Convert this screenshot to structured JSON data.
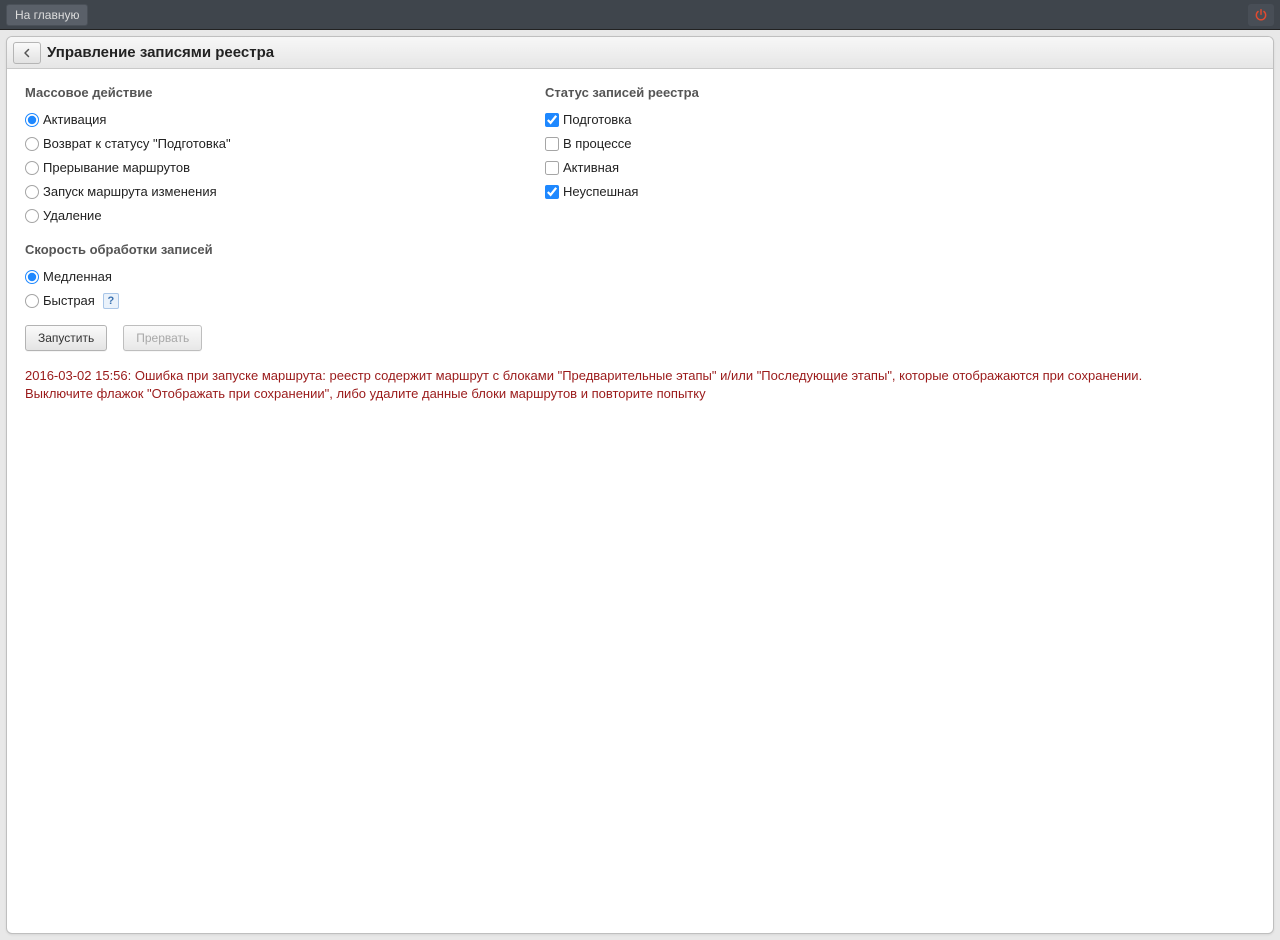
{
  "appbar": {
    "home_label": "На главную"
  },
  "panel": {
    "title": "Управление записями реестра"
  },
  "mass_action": {
    "label": "Массовое действие",
    "options": {
      "activation": "Активация",
      "return_prep": "Возврат к статусу \"Подготовка\"",
      "interrupt": "Прерывание маршрутов",
      "start_change": "Запуск маршрута изменения",
      "delete": "Удаление"
    },
    "selected": "activation"
  },
  "status": {
    "label": "Статус записей реестра",
    "options": {
      "prep": {
        "label": "Подготовка",
        "checked": true
      },
      "in_process": {
        "label": "В процессе",
        "checked": false
      },
      "active": {
        "label": "Активная",
        "checked": false
      },
      "failed": {
        "label": "Неуспешная",
        "checked": true
      }
    }
  },
  "speed": {
    "label": "Скорость обработки записей",
    "options": {
      "slow": "Медленная",
      "fast": "Быстрая"
    },
    "selected": "slow",
    "help": "?"
  },
  "buttons": {
    "start": "Запустить",
    "abort": "Прервать"
  },
  "error": "2016-03-02 15:56: Ошибка при запуске маршрута: реестр содержит маршрут с блоками \"Предварительные этапы\" и/или \"Последующие этапы\", которые отображаются при сохранении. Выключите флажок \"Отображать при сохранении\", либо удалите данные блоки маршрутов и повторите попытку"
}
